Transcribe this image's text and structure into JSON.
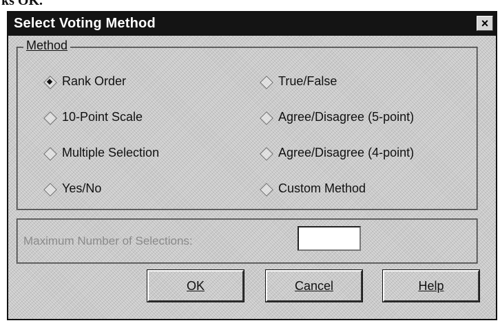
{
  "page_text": "ks OK.",
  "dialog": {
    "title": "Select Voting Method",
    "close_glyph": "×",
    "method_group_label": "Method",
    "radios": [
      {
        "label": "Rank Order",
        "checked": true
      },
      {
        "label": "10-Point Scale",
        "checked": false
      },
      {
        "label": "Multiple Selection",
        "checked": false
      },
      {
        "label": "Yes/No",
        "checked": false
      },
      {
        "label": "True/False",
        "checked": false
      },
      {
        "label": "Agree/Disagree (5-point)",
        "checked": false
      },
      {
        "label": "Agree/Disagree (4-point)",
        "checked": false
      },
      {
        "label": "Custom Method",
        "checked": false
      }
    ],
    "max_selections_label": "Maximum Number of Selections:",
    "max_selections_value": "",
    "buttons": {
      "ok": "OK",
      "cancel": "Cancel",
      "help": "Help"
    }
  },
  "icons": {
    "close": "close-icon",
    "radio": "radio-diamond-icon"
  }
}
